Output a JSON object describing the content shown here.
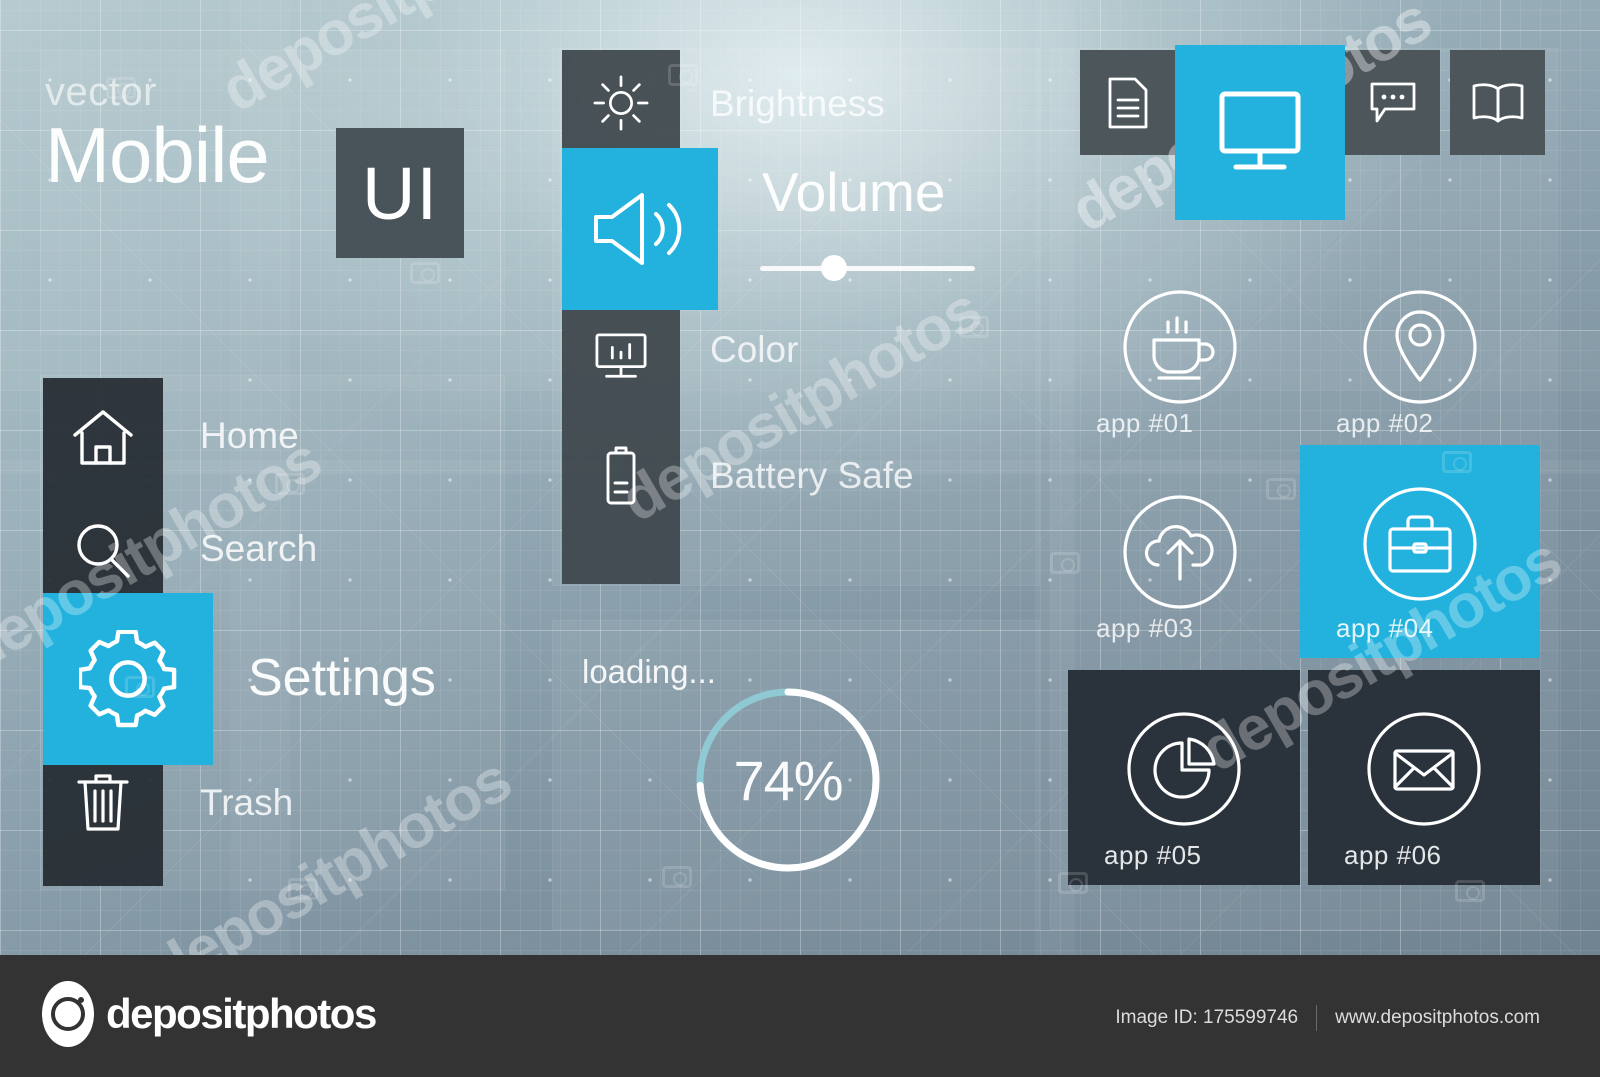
{
  "brand": {
    "sub": "vector",
    "main": "Mobile",
    "badge": "UI"
  },
  "menu": {
    "items": [
      {
        "label": "Home",
        "icon": "home-icon",
        "active": false
      },
      {
        "label": "Search",
        "icon": "search-icon",
        "active": false
      },
      {
        "label": "Settings",
        "icon": "gear-icon",
        "active": true
      },
      {
        "label": "Trash",
        "icon": "trash-icon",
        "active": false
      }
    ]
  },
  "settings": {
    "rows": [
      {
        "label": "Brightness",
        "icon": "sun-icon",
        "active": false
      },
      {
        "label": "Volume",
        "icon": "speaker-icon",
        "active": true
      },
      {
        "label": "Color",
        "icon": "monitor-bars-icon",
        "active": false
      },
      {
        "label": "Battery Safe",
        "icon": "battery-icon",
        "active": false
      }
    ],
    "volume_slider": {
      "value": 32,
      "min": 0,
      "max": 100
    }
  },
  "loading": {
    "label": "loading...",
    "percent_text": "74%",
    "percent": 74
  },
  "tabs": [
    {
      "name": "document-icon",
      "active": false
    },
    {
      "name": "display-icon",
      "active": true
    },
    {
      "name": "chat-icon",
      "active": false
    },
    {
      "name": "book-icon",
      "active": false
    }
  ],
  "apps": [
    {
      "label": "app #01",
      "icon": "coffee-cup-icon",
      "style": "plain"
    },
    {
      "label": "app #02",
      "icon": "map-pin-icon",
      "style": "plain"
    },
    {
      "label": "app #03",
      "icon": "cloud-upload-icon",
      "style": "plain"
    },
    {
      "label": "app #04",
      "icon": "briefcase-icon",
      "style": "accent"
    },
    {
      "label": "app #05",
      "icon": "pie-chart-icon",
      "style": "dark"
    },
    {
      "label": "app #06",
      "icon": "envelope-icon",
      "style": "dark"
    }
  ],
  "watermark": {
    "brand": "depositphotos",
    "image_id": "Image ID: 175599746",
    "site": "www.depositphotos.com",
    "tile_text": "depositphotos"
  },
  "colors": {
    "accent": "#22b2dd",
    "dark_tile": "#2a333c",
    "menu_col": "#252b31",
    "settings_col": "#3d464b",
    "tab_bg": "#4c565b",
    "badge": "#49545a",
    "progress_track": "#8fc9d4",
    "progress_fill": "#ffffff",
    "footer_bg": "#333333"
  }
}
